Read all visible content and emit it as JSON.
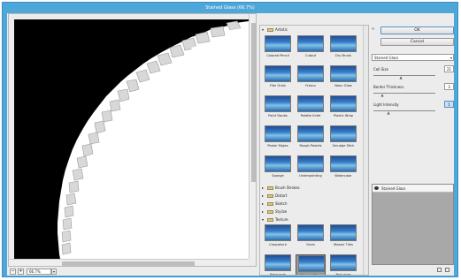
{
  "window": {
    "title": "Stained Glass (66.7%)"
  },
  "preview": {
    "zoom_minus": "−",
    "zoom_plus": "+",
    "zoom_value": "66.7%",
    "zoom_dropdown_icon": "chevron-down-icon"
  },
  "gallery": {
    "artistic": {
      "label": "Artistic",
      "items": [
        "Colored Pencil",
        "Cutout",
        "Dry Brush",
        "Film Grain",
        "Fresco",
        "Neon Glow",
        "Paint Daubs",
        "Palette Knife",
        "Plastic Wrap",
        "Poster Edges",
        "Rough Pastels",
        "Smudge Stick",
        "Sponge",
        "Underpainting",
        "Watercolor"
      ]
    },
    "collapsed_categories": [
      "Brush Strokes",
      "Distort",
      "Sketch",
      "Stylize"
    ],
    "texture": {
      "label": "Texture",
      "items": [
        "Craquelure",
        "Grain",
        "Mosaic Tiles",
        "Patchwork",
        "Stained Glass",
        "Texturizer"
      ],
      "selected": "Stained Glass"
    }
  },
  "panel": {
    "ok_label": "OK",
    "cancel_label": "Cancel",
    "filter_select": "Stained Glass",
    "params": [
      {
        "label": "Cell Size",
        "value": "21",
        "level": 0.45
      },
      {
        "label": "Border Thickness",
        "value": "3",
        "level": 0.15
      },
      {
        "label": "Light Intensity",
        "value": "1",
        "level": 0.25
      }
    ],
    "layer_name": "Stained Glass"
  },
  "colors": {
    "title_bar": "#4ea7d9",
    "selection_highlight": "#c9e0f6"
  }
}
